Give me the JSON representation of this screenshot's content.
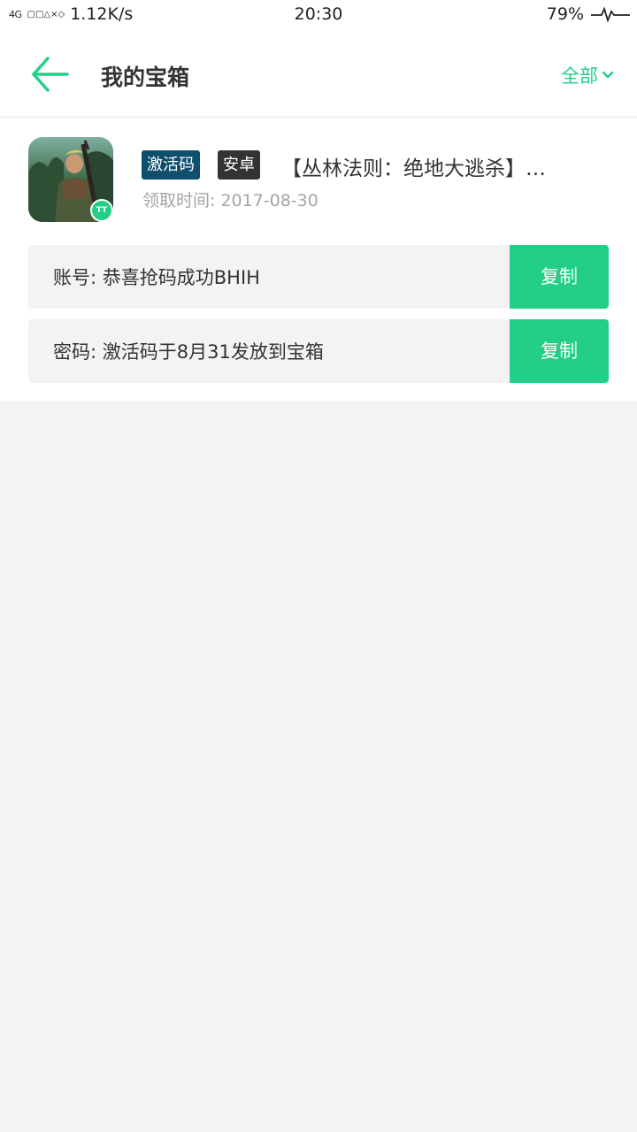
{
  "status_bar": {
    "signal": "4G",
    "speed": "1.12K/s",
    "time": "20:30",
    "battery": "79%"
  },
  "header": {
    "title": "我的宝箱",
    "filter_label": "全部",
    "accent_color": "#23cf87"
  },
  "gift": {
    "tags": [
      "激活码",
      "安卓"
    ],
    "title": "【丛林法则：绝地大逃杀】…",
    "time_label": "领取时间: 2017-08-30",
    "fields": [
      {
        "text": "账号: 恭喜抢码成功BHIH",
        "button": "复制"
      },
      {
        "text": "密码: 激活码于8月31发放到宝箱",
        "button": "复制"
      }
    ]
  }
}
